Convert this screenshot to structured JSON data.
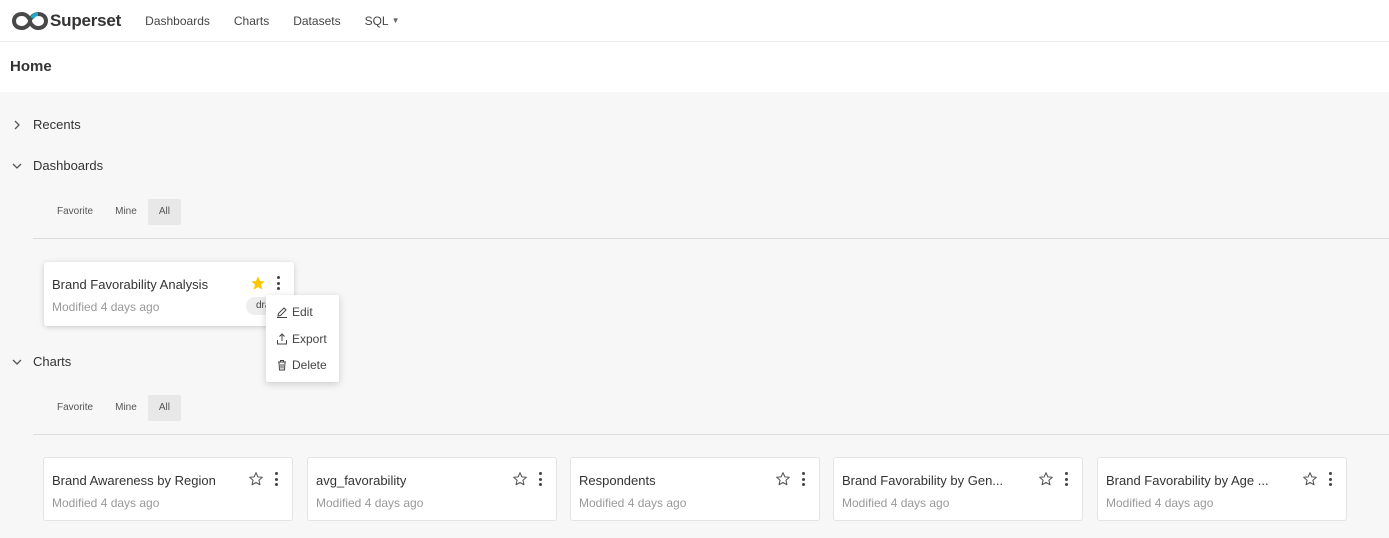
{
  "nav": {
    "brand": "Superset",
    "items": [
      "Dashboards",
      "Charts",
      "Datasets"
    ],
    "sql_label": "SQL"
  },
  "page": {
    "title": "Home"
  },
  "sections": {
    "recents": {
      "title": "Recents"
    },
    "dashboards": {
      "title": "Dashboards",
      "tabs": [
        "Favorite",
        "Mine",
        "All"
      ],
      "active_tab": "All",
      "cards": [
        {
          "title": "Brand Favorability Analysis",
          "modified": "Modified 4 days ago",
          "starred": true,
          "tag": "draft"
        }
      ]
    },
    "charts": {
      "title": "Charts",
      "tabs": [
        "Favorite",
        "Mine",
        "All"
      ],
      "active_tab": "All",
      "cards": [
        {
          "title": "Brand Awareness by Region",
          "modified": "Modified 4 days ago",
          "starred": false
        },
        {
          "title": "avg_favorability",
          "modified": "Modified 4 days ago",
          "starred": false
        },
        {
          "title": "Respondents",
          "modified": "Modified 4 days ago",
          "starred": false
        },
        {
          "title": "Brand Favorability by Gen...",
          "modified": "Modified 4 days ago",
          "starred": false
        },
        {
          "title": "Brand Favorability by Age ...",
          "modified": "Modified 4 days ago",
          "starred": false
        }
      ]
    }
  },
  "menu": {
    "items": [
      "Edit",
      "Export",
      "Delete"
    ]
  },
  "colors": {
    "accent": "#20a7c9",
    "star": "#fbc700",
    "brand_dark": "#484848"
  }
}
